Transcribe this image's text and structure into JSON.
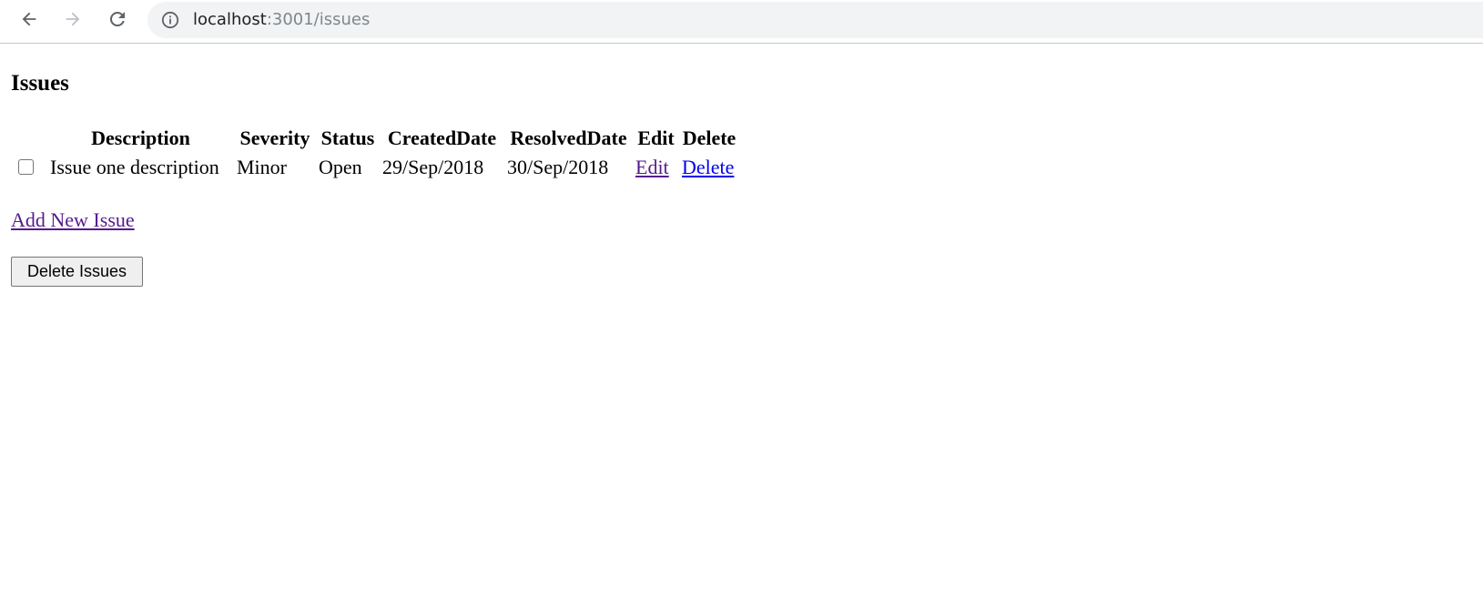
{
  "browser": {
    "url_host": "localhost",
    "url_path": ":3001/issues",
    "icons": {
      "back": "arrow-left-icon",
      "forward": "arrow-right-icon",
      "reload": "reload-icon",
      "site_info": "info-icon"
    }
  },
  "page": {
    "title": "Issues",
    "table": {
      "headers": [
        "Description",
        "Severity",
        "Status",
        "CreatedDate",
        "ResolvedDate",
        "Edit",
        "Delete"
      ],
      "rows": [
        {
          "checked": false,
          "description": "Issue one description",
          "severity": "Minor",
          "status": "Open",
          "created_date": "29/Sep/2018",
          "resolved_date": "30/Sep/2018",
          "edit_label": "Edit",
          "delete_label": "Delete"
        }
      ]
    },
    "add_link_label": "Add New Issue",
    "delete_button_label": "Delete Issues"
  },
  "colors": {
    "visited_link": "#551a8b",
    "link": "#0000ee",
    "omnibox_bg": "#f1f3f4"
  }
}
